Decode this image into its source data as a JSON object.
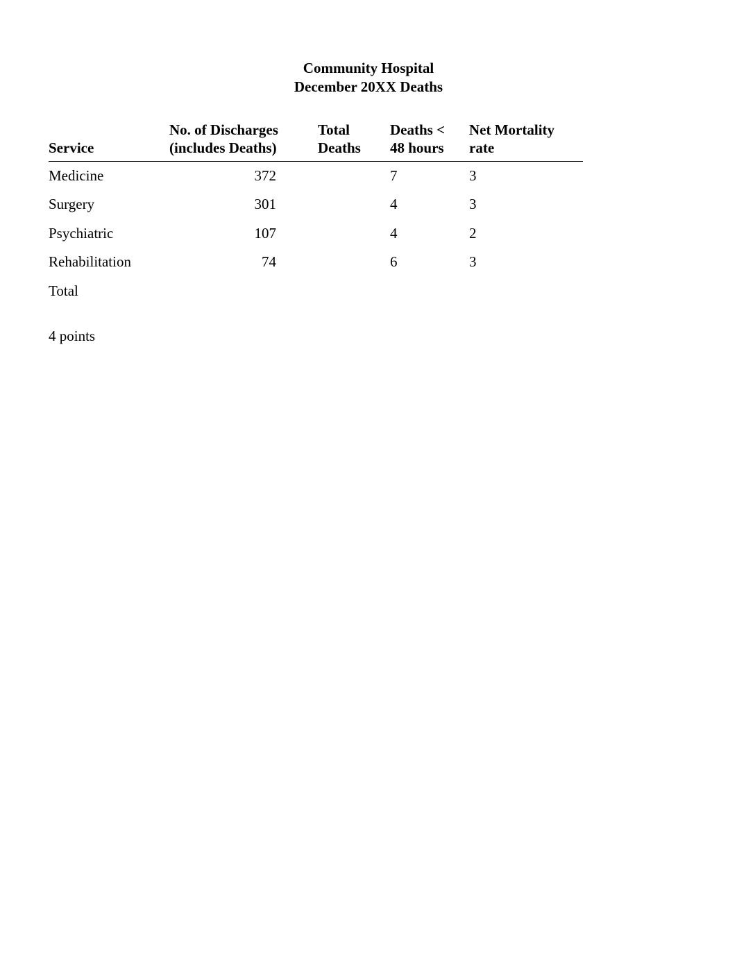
{
  "title": {
    "line1": "Community Hospital",
    "line2": "December 20XX Deaths"
  },
  "chart_data": {
    "type": "table",
    "columns": [
      "Service",
      "No. of Discharges (includes Deaths)",
      "Total Deaths",
      "Deaths < 48 hours",
      "Net Mortality rate"
    ],
    "rows": [
      {
        "service": "Medicine",
        "discharges": 372,
        "total_deaths": "",
        "deaths_lt_48h": 7,
        "net_mortality_rate": 3
      },
      {
        "service": "Surgery",
        "discharges": 301,
        "total_deaths": "",
        "deaths_lt_48h": 4,
        "net_mortality_rate": 3
      },
      {
        "service": "Psychiatric",
        "discharges": 107,
        "total_deaths": "",
        "deaths_lt_48h": 4,
        "net_mortality_rate": 2
      },
      {
        "service": "Rehabilitation",
        "discharges": 74,
        "total_deaths": "",
        "deaths_lt_48h": 6,
        "net_mortality_rate": 3
      }
    ],
    "total_row_label": "Total"
  },
  "headers": {
    "service": "Service",
    "discharges_l1": "No. of Discharges",
    "discharges_l2": "(includes Deaths)",
    "total_deaths_l1": "Total",
    "total_deaths_l2": "Deaths",
    "deaths48_l1": "Deaths <",
    "deaths48_l2": "48 hours",
    "nmr_l1": "Net Mortality",
    "nmr_l2": "rate"
  },
  "rows": {
    "0": {
      "service": "Medicine",
      "discharges": "372",
      "total_deaths": "",
      "deaths48": "7",
      "nmr": "3"
    },
    "1": {
      "service": "Surgery",
      "discharges": "301",
      "total_deaths": "",
      "deaths48": "4",
      "nmr": "3"
    },
    "2": {
      "service": "Psychiatric",
      "discharges": "107",
      "total_deaths": "",
      "deaths48": "4",
      "nmr": "2"
    },
    "3": {
      "service": "Rehabilitation",
      "discharges": "74",
      "total_deaths": "",
      "deaths48": "6",
      "nmr": "3"
    }
  },
  "total_label": "Total",
  "footer_note": "4 points"
}
